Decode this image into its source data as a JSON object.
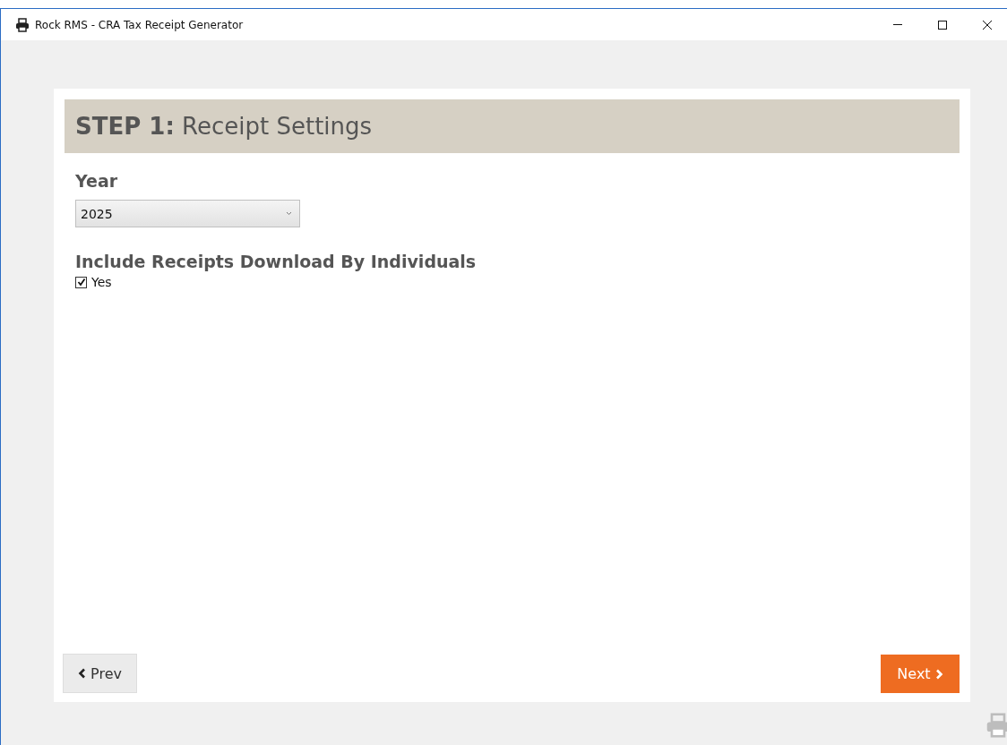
{
  "window": {
    "title": "Rock RMS - CRA Tax Receipt Generator"
  },
  "step": {
    "heading": "**STEP 1:** Receipt Settings"
  },
  "year": {
    "label": "Year",
    "value": "2025"
  },
  "include": {
    "label": "Include Receipts Download By Individuals",
    "option": "Yes",
    "checked": true
  },
  "buttons": {
    "prev": "Prev",
    "next": "Next"
  }
}
